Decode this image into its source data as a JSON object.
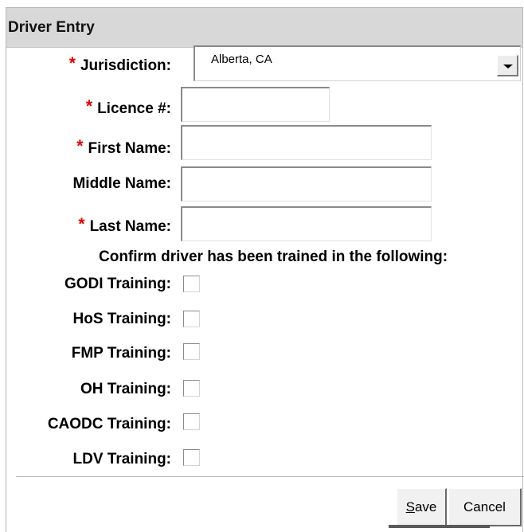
{
  "dialog": {
    "title": "Driver Entry"
  },
  "fields": {
    "required_marker": "*",
    "jurisdiction": {
      "label": "Jurisdiction:",
      "value": "Alberta, CA"
    },
    "licence": {
      "label": "Licence #:",
      "value": ""
    },
    "first_name": {
      "label": "First Name:",
      "value": ""
    },
    "middle_name": {
      "label": "Middle Name:",
      "value": ""
    },
    "last_name": {
      "label": "Last Name:",
      "value": ""
    }
  },
  "training": {
    "heading": "Confirm driver has been trained in the following:",
    "items": [
      {
        "label": "GODI Training:",
        "checked": false
      },
      {
        "label": "HoS Training:",
        "checked": false
      },
      {
        "label": "FMP Training:",
        "checked": false
      },
      {
        "label": "OH Training:",
        "checked": false
      },
      {
        "label": "CAODC Training:",
        "checked": false
      },
      {
        "label": "LDV Training:",
        "checked": false
      }
    ]
  },
  "buttons": {
    "save_mnemonic": "S",
    "save_rest": "ave",
    "cancel": "Cancel"
  },
  "colors": {
    "required": "#e00000",
    "titlebar": "#d8d8d8"
  }
}
